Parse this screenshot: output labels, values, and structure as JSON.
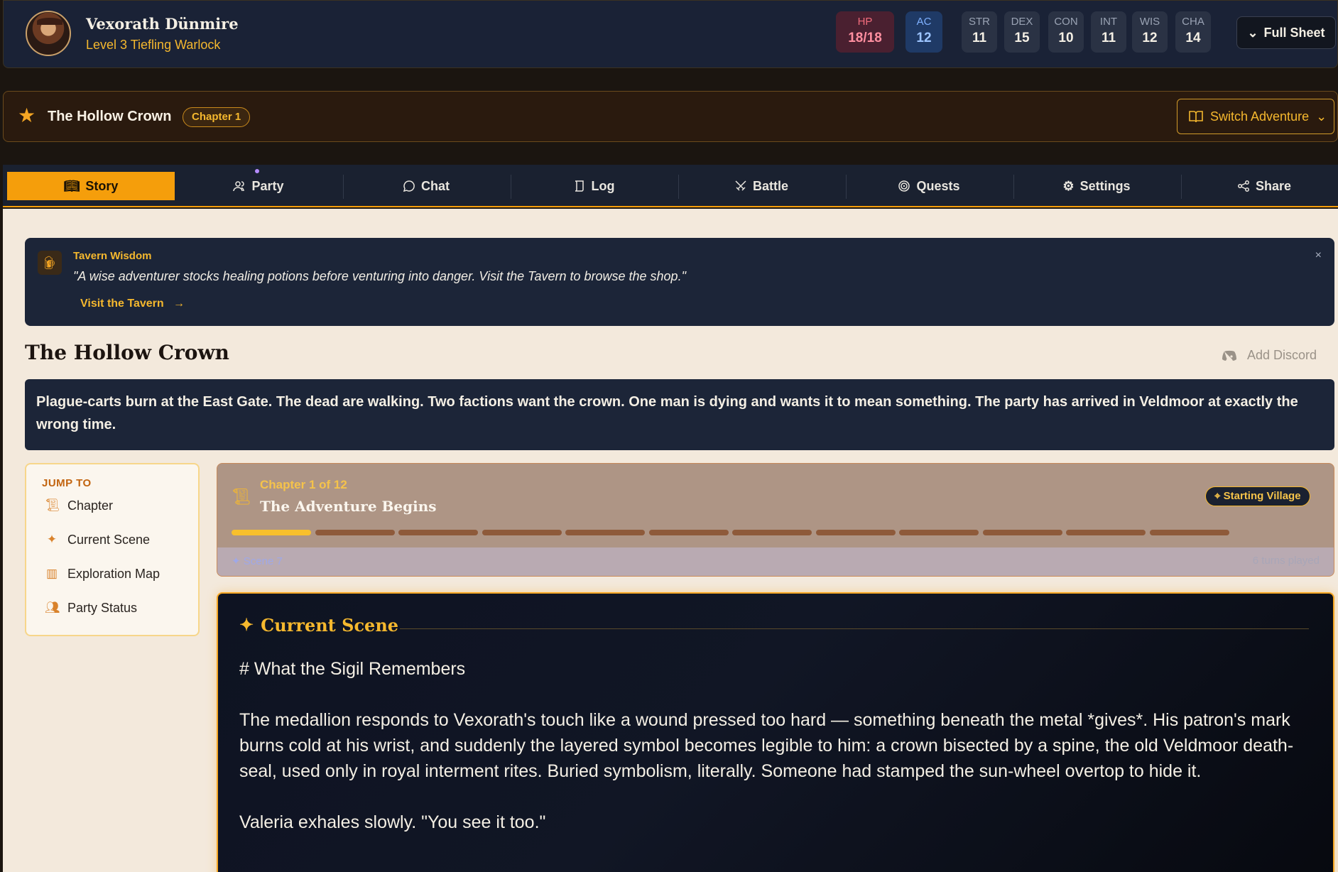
{
  "character": {
    "name": "Vexorath Dünmire",
    "subtitle": "Level 3 Tiefling Warlock",
    "hp_label": "HP",
    "hp": "18/18",
    "ac_label": "AC",
    "ac": "12",
    "abilities": [
      {
        "label": "STR",
        "value": "11"
      },
      {
        "label": "DEX",
        "value": "15"
      },
      {
        "label": "CON",
        "value": "10"
      },
      {
        "label": "INT",
        "value": "11"
      },
      {
        "label": "WIS",
        "value": "12"
      },
      {
        "label": "CHA",
        "value": "14"
      }
    ],
    "full_sheet_label": "Full Sheet"
  },
  "adventure": {
    "title": "The Hollow Crown",
    "chapter_badge": "Chapter 1",
    "switch_label": "Switch Adventure"
  },
  "tabs": [
    {
      "label": "Story",
      "icon": "book-icon"
    },
    {
      "label": "Party",
      "icon": "users-icon"
    },
    {
      "label": "Chat",
      "icon": "chat-icon"
    },
    {
      "label": "Log",
      "icon": "scroll-icon"
    },
    {
      "label": "Battle",
      "icon": "swords-icon"
    },
    {
      "label": "Quests",
      "icon": "target-icon"
    },
    {
      "label": "Settings",
      "icon": "gear-icon"
    },
    {
      "label": "Share",
      "icon": "share-icon"
    }
  ],
  "tip": {
    "title": "Tavern Wisdom",
    "text": "\"A wise adventurer stocks healing potions before venturing into danger. Visit the Tavern to browse the shop.\"",
    "link": "Visit the Tavern",
    "close": "×"
  },
  "story": {
    "title": "The Hollow Crown",
    "add_discord": "Add Discord",
    "summary": "Plague-carts burn at the East Gate. The dead are walking. Two factions want the crown. One man is dying and wants it to mean something. The party has arrived in Veldmoor at exactly the wrong time."
  },
  "jump": {
    "title": "JUMP TO",
    "items": [
      "Chapter",
      "Current Scene",
      "Exploration Map",
      "Party Status"
    ]
  },
  "chapter": {
    "number": "Chapter 1 of 12",
    "name": "The Adventure Begins",
    "location": "Starting Village",
    "scene_label": "Scene 7",
    "turns": "6 turns played",
    "progress_done": 1,
    "progress_total": 12
  },
  "scene": {
    "header": "Current Scene",
    "heading": "# What the Sigil Remembers",
    "paragraph1": "The medallion responds to Vexorath's touch like a wound pressed too hard — something beneath the metal *gives*. His patron's mark burns cold at his wrist, and suddenly the layered symbol becomes legible to him: a crown bisected by a spine, the old Veldmoor death-seal, used only in royal interment rites. Buried symbolism, literally. Someone had stamped the sun-wheel overtop to hide it.",
    "paragraph2": "Valeria exhales slowly. \"You see it too.\""
  },
  "colors": {
    "accent": "#f59e0b",
    "panel": "#1c2538",
    "page_bg": "#f3e9dc"
  }
}
